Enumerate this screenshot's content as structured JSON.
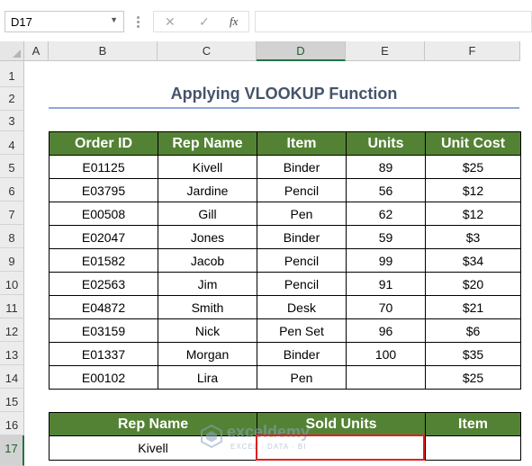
{
  "formula_bar": {
    "name_box": "D17",
    "cancel_glyph": "✕",
    "enter_glyph": "✓",
    "fx_label": "fx",
    "formula": ""
  },
  "columns": [
    "A",
    "B",
    "C",
    "D",
    "E",
    "F"
  ],
  "rows": [
    "1",
    "2",
    "3",
    "4",
    "5",
    "6",
    "7",
    "8",
    "9",
    "10",
    "11",
    "12",
    "13",
    "14",
    "15",
    "16",
    "17"
  ],
  "selected_cell": {
    "column": "D",
    "row": "17"
  },
  "title": "Applying VLOOKUP Function",
  "main_table": {
    "headers": [
      "Order ID",
      "Rep Name",
      "Item",
      "Units",
      "Unit Cost"
    ],
    "rows": [
      [
        "E01125",
        "Kivell",
        "Binder",
        "89",
        "$25"
      ],
      [
        "E03795",
        "Jardine",
        "Pencil",
        "56",
        "$12"
      ],
      [
        "E00508",
        "Gill",
        "Pen",
        "62",
        "$12"
      ],
      [
        "E02047",
        "Jones",
        "Binder",
        "59",
        "$3"
      ],
      [
        "E01582",
        "Jacob",
        "Pencil",
        "99",
        "$34"
      ],
      [
        "E02563",
        "Jim",
        "Pencil",
        "91",
        "$20"
      ],
      [
        "E04872",
        "Smith",
        "Desk",
        "70",
        "$21"
      ],
      [
        "E03159",
        "Nick",
        "Pen Set",
        "96",
        "$6"
      ],
      [
        "E01337",
        "Morgan",
        "Binder",
        "100",
        "$35"
      ],
      [
        "E00102",
        "Lira",
        "Pen",
        "",
        "$25"
      ]
    ]
  },
  "lookup_table": {
    "headers": [
      "Rep Name",
      "Sold Units",
      "Item"
    ],
    "row": [
      "Kivell",
      "",
      ""
    ]
  },
  "watermark": {
    "name": "exceldemy",
    "tagline": "EXCEL · DATA · BI"
  },
  "colors": {
    "header_green": "#548235",
    "title": "#44546a",
    "title_underline": "#8ea9db",
    "highlight": "#e02020",
    "excel_green": "#217346"
  }
}
